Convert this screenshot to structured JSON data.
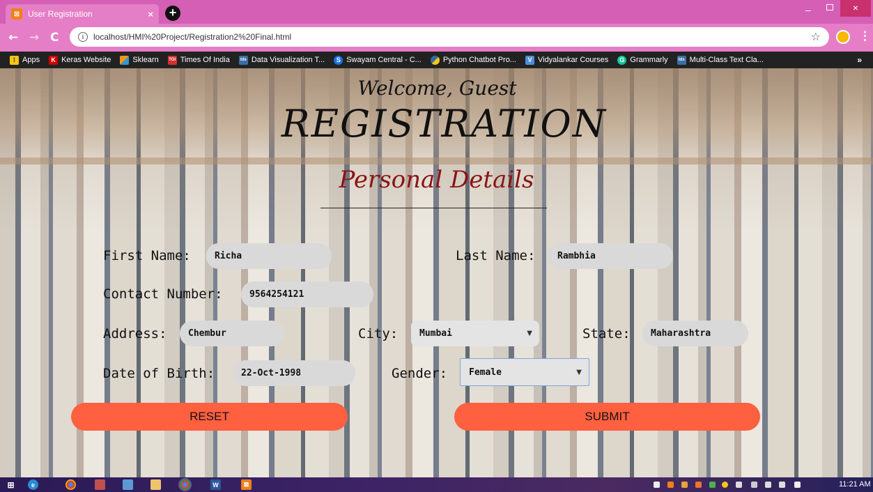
{
  "browser": {
    "tab_title": "User Registration",
    "tab_close": "×",
    "new_tab": "+",
    "window_min": "–",
    "window_close": "×",
    "url": "localhost/HMI%20Project/Registration2%20Final.html",
    "nav": {
      "back": "←",
      "forward": "→",
      "reload": "C",
      "info": "i",
      "star": "☆",
      "menu": "⋮"
    },
    "bookmarks": [
      {
        "label": "Apps",
        "icon": "apps-grid-icon",
        "color": "#f5c518"
      },
      {
        "label": "Keras Website",
        "icon": "keras-icon",
        "color": "#d00000",
        "glyph": "K"
      },
      {
        "label": "Sklearn",
        "icon": "sklearn-icon",
        "color": "#f7931e"
      },
      {
        "label": "Times Of India",
        "icon": "toi-icon",
        "color": "#d32f2f"
      },
      {
        "label": "Data Visualization T...",
        "icon": "tds-icon",
        "color": "#3b6ea5"
      },
      {
        "label": "Swayam Central - C...",
        "icon": "swayam-icon",
        "color": "#1a73e8"
      },
      {
        "label": "Python Chatbot Pro...",
        "icon": "python-icon",
        "color": "#2f6aa6"
      },
      {
        "label": "Vidyalankar Courses",
        "icon": "vidyalankar-icon",
        "color": "#4a90d9"
      },
      {
        "label": "Grammarly",
        "icon": "grammarly-icon",
        "color": "#15c39a",
        "glyph": "G"
      },
      {
        "label": "Multi-Class Text Cla...",
        "icon": "tds-icon",
        "color": "#3b6ea5"
      }
    ],
    "bookmarks_more": "»"
  },
  "page": {
    "welcome": "Welcome, Guest",
    "heading": "REGISTRATION",
    "subheading": "Personal Details",
    "labels": {
      "first_name": "First Name:",
      "last_name": "Last Name:",
      "contact": "Contact Number:",
      "address": "Address:",
      "city": "City:",
      "state": "State:",
      "dob": "Date of Birth:",
      "gender": "Gender:"
    },
    "values": {
      "first_name": "Richa",
      "last_name": "Rambhia",
      "contact": "9564254121",
      "address": "Chembur",
      "city": "Mumbai",
      "state": "Maharashtra",
      "dob": "22-Oct-1998",
      "gender": "Female"
    },
    "buttons": {
      "reset": "RESET",
      "submit": "SUBMIT"
    },
    "button_color": "#ff6040",
    "subheading_color": "#8a1414"
  },
  "taskbar": {
    "clock": "11:21 AM"
  }
}
